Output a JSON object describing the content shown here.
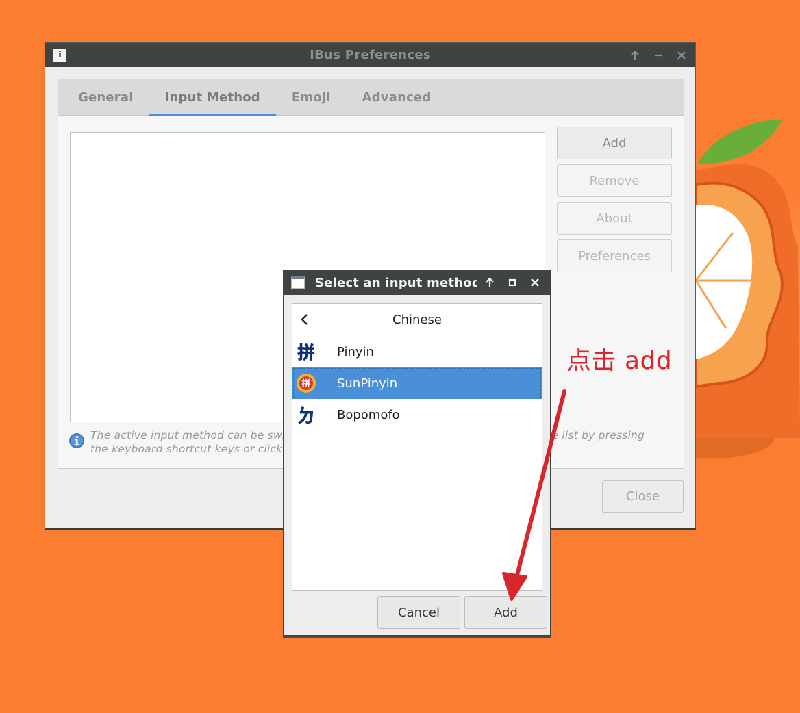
{
  "main_window": {
    "title": "IBus Preferences",
    "tabs": [
      {
        "label": "General"
      },
      {
        "label": "Input Method"
      },
      {
        "label": "Emoji"
      },
      {
        "label": "Advanced"
      }
    ],
    "buttons": {
      "add": "Add",
      "remove": "Remove",
      "about": "About",
      "preferences": "Preferences"
    },
    "hint": {
      "line1": "The active input method can be switched around from the selected ones in the above list by pressing",
      "line2": "the keyboard shortcut keys or clicking the panel icon."
    },
    "close_label": "Close"
  },
  "dialog": {
    "title": "Select an input method",
    "language": "Chinese",
    "items": [
      {
        "label": "Pinyin",
        "icon": "pinyin-icon"
      },
      {
        "label": "SunPinyin",
        "icon": "sunpinyin-icon",
        "selected": true
      },
      {
        "label": "Bopomofo",
        "icon": "bopomofo-icon"
      }
    ],
    "cancel_label": "Cancel",
    "add_label": "Add"
  },
  "annotation": {
    "text": "点击 add",
    "color": "#d8262d"
  },
  "colors": {
    "desktop": "#fb7d31",
    "titlebar": "#3f4341",
    "accent": "#4a90d9"
  }
}
